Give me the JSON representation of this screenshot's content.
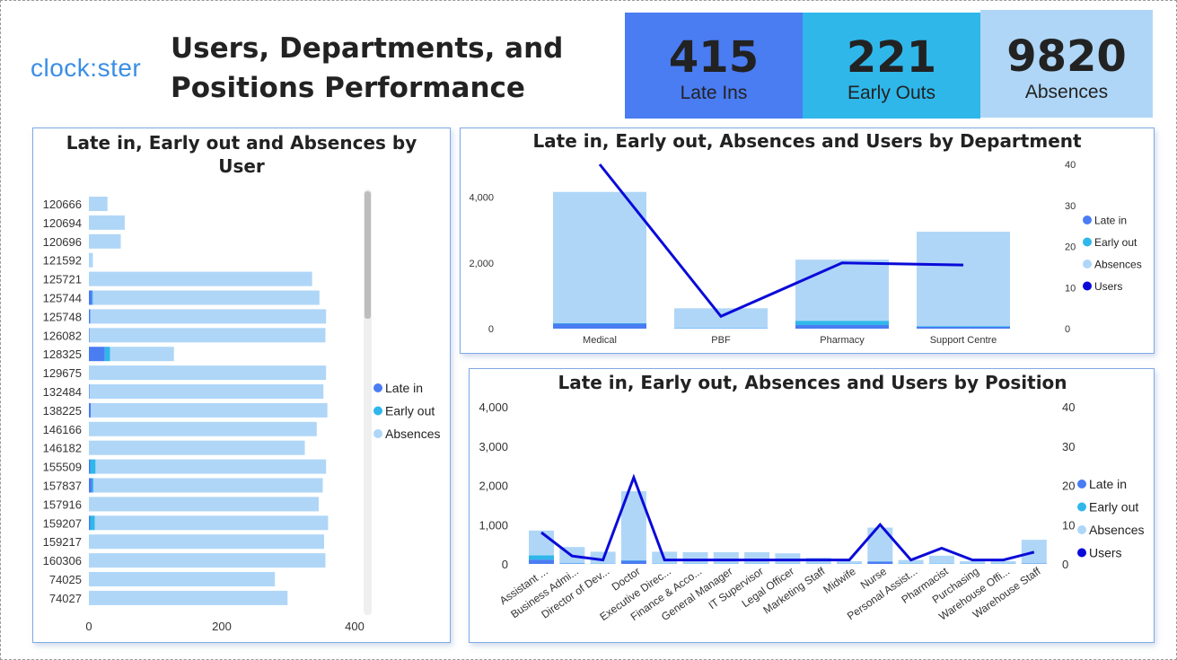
{
  "logo_text": "clock:ster",
  "page_title_line1": "Users, Departments, and",
  "page_title_line2": "Positions Performance",
  "kpis": {
    "late_ins": {
      "value": "415",
      "label": "Late Ins",
      "color": "#4a7cf2"
    },
    "early_outs": {
      "value": "221",
      "label": "Early Outs",
      "color": "#2fb7ea"
    },
    "absences": {
      "value": "9820",
      "label": "Absences",
      "color": "#afd6f7"
    }
  },
  "colors": {
    "late_in": "#4a7cf2",
    "early_out": "#2fb7ea",
    "absences": "#afd6f7",
    "users": "#0a0ad9"
  },
  "legend": {
    "late_in": "Late in",
    "early_out": "Early out",
    "absences": "Absences",
    "users": "Users"
  },
  "chart_data": [
    {
      "type": "bar",
      "orientation": "horizontal",
      "stacked": true,
      "title_line1": "Late in, Early out and Absences by",
      "title_line2": "User",
      "categories": [
        "120666",
        "120694",
        "120696",
        "121592",
        "125721",
        "125744",
        "125748",
        "126082",
        "128325",
        "129675",
        "132484",
        "138225",
        "146166",
        "146182",
        "155509",
        "157837",
        "157916",
        "159207",
        "159217",
        "160306",
        "74025",
        "74027"
      ],
      "series": [
        {
          "name": "Late in",
          "values": [
            0,
            0,
            0,
            0,
            0,
            5,
            2,
            1,
            24,
            0,
            1,
            3,
            0,
            0,
            2,
            5,
            0,
            2,
            0,
            0,
            0,
            0
          ]
        },
        {
          "name": "Early out",
          "values": [
            0,
            0,
            0,
            0,
            0,
            1,
            0,
            0,
            8,
            0,
            0,
            0,
            0,
            0,
            8,
            2,
            0,
            7,
            0,
            0,
            0,
            0
          ]
        },
        {
          "name": "Absences",
          "values": [
            28,
            54,
            48,
            6,
            336,
            341,
            355,
            355,
            96,
            357,
            352,
            356,
            343,
            325,
            347,
            345,
            346,
            351,
            354,
            356,
            280,
            299
          ]
        }
      ],
      "x_ticks": [
        "0",
        "200",
        "400"
      ],
      "xlim": [
        0,
        400
      ],
      "legend_position": "right"
    },
    {
      "type": "bar",
      "stacked": true,
      "secondary_line": true,
      "title": "Late in, Early out, Absences and Users by Department",
      "categories": [
        "Medical",
        "PBF",
        "Pharmacy",
        "Support Centre"
      ],
      "series": [
        {
          "name": "Late in",
          "values": [
            150,
            10,
            110,
            60
          ]
        },
        {
          "name": "Early out",
          "values": [
            20,
            10,
            130,
            20
          ]
        },
        {
          "name": "Absences",
          "values": [
            3990,
            600,
            1860,
            2870
          ]
        },
        {
          "name": "Users",
          "axis": "secondary",
          "values": [
            40,
            3,
            16,
            15.5
          ]
        }
      ],
      "y_ticks": [
        "0",
        "2,000",
        "4,000"
      ],
      "ylim": [
        0,
        5000
      ],
      "y2_ticks": [
        "0",
        "10",
        "20",
        "30",
        "40"
      ],
      "y2lim": [
        0,
        40
      ],
      "legend_position": "right"
    },
    {
      "type": "bar",
      "stacked": true,
      "secondary_line": true,
      "title": "Late in, Early out, Absences and Users by Position",
      "categories": [
        "Assistant ...",
        "Business Admi...",
        "Director of Dev...",
        "Doctor",
        "Executive Direc...",
        "Finance & Acco...",
        "General Manager",
        "IT Supervisor",
        "Legal Officer",
        "Marketing Staff",
        "Midwife",
        "Nurse",
        "Personal Assist...",
        "Pharmacist",
        "Purchasing",
        "Warehouse Offi...",
        "Warehouse Staff"
      ],
      "series": [
        {
          "name": "Late in",
          "values": [
            110,
            10,
            5,
            80,
            5,
            5,
            5,
            5,
            5,
            5,
            5,
            60,
            5,
            5,
            5,
            5,
            10
          ]
        },
        {
          "name": "Early out",
          "values": [
            110,
            10,
            5,
            10,
            5,
            5,
            5,
            5,
            5,
            5,
            5,
            5,
            5,
            5,
            5,
            5,
            5
          ]
        },
        {
          "name": "Absences",
          "values": [
            630,
            410,
            300,
            1760,
            300,
            290,
            290,
            290,
            260,
            150,
            60,
            860,
            90,
            200,
            60,
            60,
            600
          ]
        },
        {
          "name": "Users",
          "axis": "secondary",
          "values": [
            8,
            2,
            1,
            22,
            1,
            1,
            1,
            1,
            1,
            1,
            1,
            10,
            1,
            4,
            1,
            1,
            3
          ]
        }
      ],
      "y_ticks": [
        "0",
        "1,000",
        "2,000",
        "3,000",
        "4,000"
      ],
      "ylim": [
        0,
        4000
      ],
      "y2_ticks": [
        "0",
        "10",
        "20",
        "30",
        "40"
      ],
      "y2lim": [
        0,
        40
      ],
      "legend_position": "right"
    }
  ]
}
